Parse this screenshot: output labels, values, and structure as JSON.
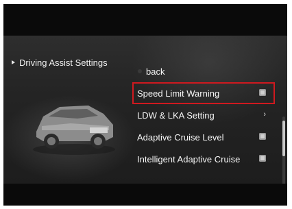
{
  "header": {
    "title": "Driving Assist Settings",
    "title_icon": "play-icon"
  },
  "menu": {
    "back_label": "back",
    "items": [
      {
        "label": "Speed Limit Warning",
        "right_icon": "checkbox-icon",
        "selected": true
      },
      {
        "label": "LDW & LKA Setting",
        "right_icon": "chevron-right-icon",
        "selected": false
      },
      {
        "label": "Adaptive Cruise Level",
        "right_icon": "checkbox-icon",
        "selected": false
      },
      {
        "label": "Intelligent Adaptive Cruise",
        "right_icon": "checkbox-icon",
        "selected": false
      }
    ]
  },
  "colors": {
    "selection_outline": "#d0191f",
    "text": "#f5f5f5",
    "background": "#242424"
  },
  "scroll": {
    "position_fraction": 0.1,
    "visible_fraction": 0.5
  }
}
